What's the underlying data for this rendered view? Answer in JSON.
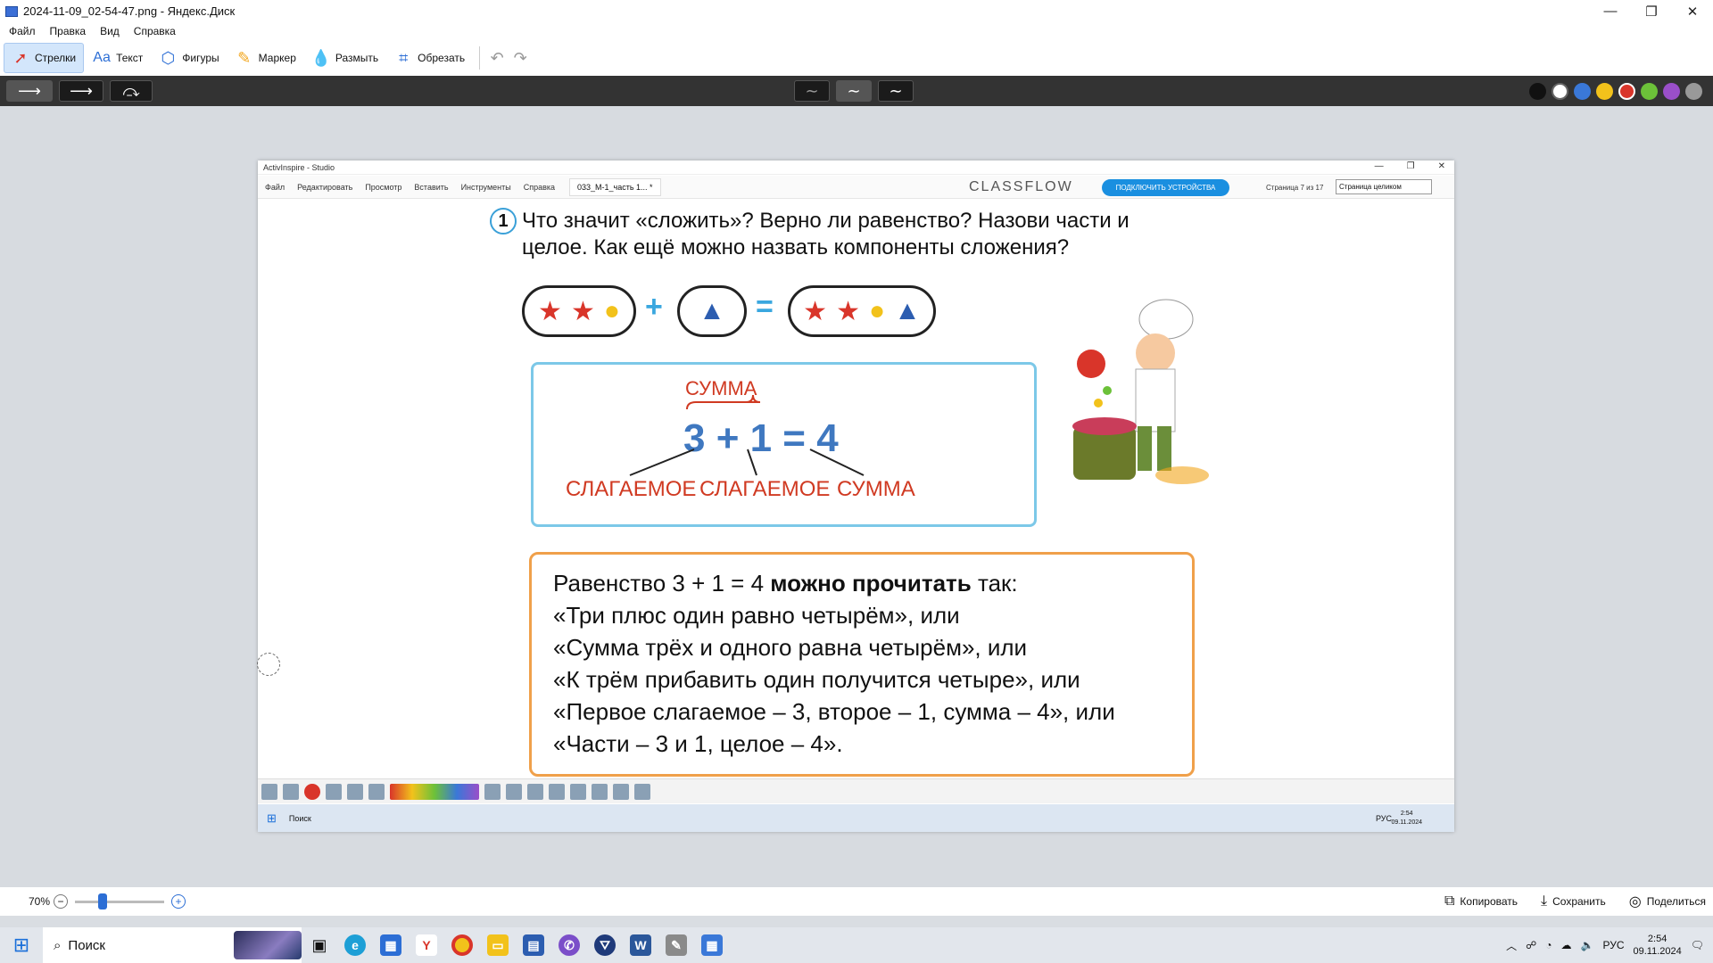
{
  "window": {
    "title": "2024-11-09_02-54-47.png - Яндекс.Диск"
  },
  "menu": [
    "Файл",
    "Правка",
    "Вид",
    "Справка"
  ],
  "tools": [
    {
      "label": "Стрелки",
      "icon": "arrow-icon",
      "active": true
    },
    {
      "label": "Текст",
      "icon": "text-icon"
    },
    {
      "label": "Фигуры",
      "icon": "shapes-icon"
    },
    {
      "label": "Маркер",
      "icon": "marker-icon"
    },
    {
      "label": "Размыть",
      "icon": "blur-icon"
    },
    {
      "label": "Обрезать",
      "icon": "crop-icon"
    }
  ],
  "colors": [
    "#111111",
    "#ffffff",
    "#3a78d8",
    "#f2c21b",
    "#d9352a",
    "#6cc139",
    "#9a4fc9",
    "#999999"
  ],
  "inner": {
    "app_title": "ActivInspire - Studio",
    "menu": [
      "Файл",
      "Редактировать",
      "Просмотр",
      "Вставить",
      "Инструменты",
      "Справка"
    ],
    "doc_tab": "033_М-1_часть 1... *",
    "brand": "CLASSFLOW",
    "connect_button": "ПОДКЛЮЧИТЬ УСТРОЙСТВА",
    "page_info": "Страница 7 из 17",
    "page_view": "Страница целиком",
    "task_search": "Поиск",
    "task_lang": "РУС",
    "task_time": "2:54",
    "task_date": "09.11.2024"
  },
  "page": {
    "question_number": "1",
    "question_line1": "Что значит «сложить»? Верно ли равенство? Назови части и",
    "question_line2": "целое. Как ещё можно назвать компоненты сложения?",
    "plus": "+",
    "equals": "=",
    "sum_top": "СУММА",
    "formula": "3 + 1 = 4",
    "label_addend1": "СЛАГАЕМОЕ",
    "label_addend2": "СЛАГАЕМОЕ",
    "label_sum": "СУММА",
    "read_intro": "Равенство 3 + 1 = 4",
    "read_bold": "можно прочитать",
    "read_end": "так:",
    "read_lines": [
      "«Три плюс один равно четырём», или",
      "«Сумма трёх и одного равна четырём», или",
      "«К трём прибавить один получится четыре», или",
      "«Первое слагаемое – 3, второе – 1, сумма – 4», или",
      "«Части – 3 и 1, целое – 4»."
    ]
  },
  "bottom": {
    "zoom": "70%",
    "copy": "Копировать",
    "save": "Сохранить",
    "share": "Поделиться"
  },
  "taskbar": {
    "search": "Поиск",
    "lang": "РУС",
    "time": "2:54",
    "date": "09.11.2024"
  }
}
